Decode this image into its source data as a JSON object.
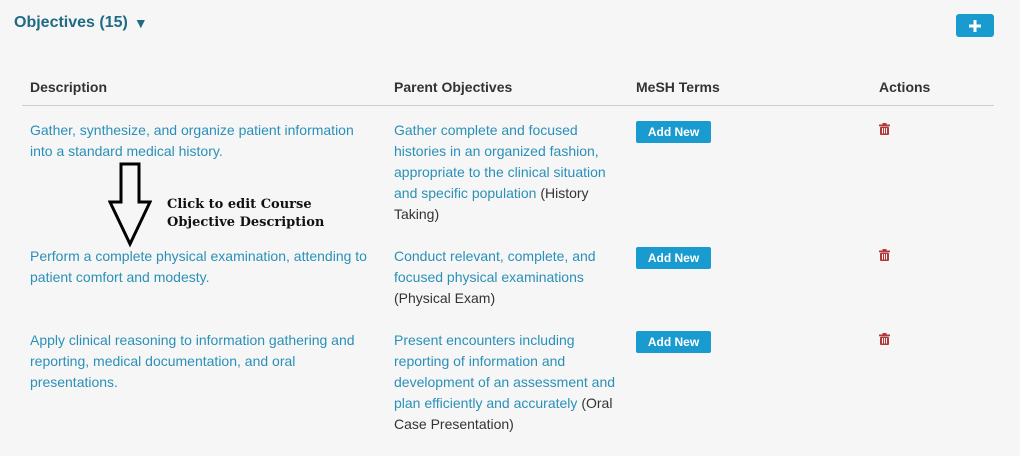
{
  "header": {
    "title": "Objectives (15)",
    "caret_icon": "triangle-down-icon"
  },
  "toolbar": {
    "add_icon": "plus-icon",
    "accent_color": "#1a9bd0"
  },
  "table": {
    "columns": {
      "description": "Description",
      "parent": "Parent Objectives",
      "mesh": "MeSH Terms",
      "actions": "Actions"
    },
    "rows": [
      {
        "description": "Gather, synthesize, and organize patient information into a standard medical history.",
        "parent_text": "Gather complete and focused histories in an organized fashion, appropriate to the clinical situation and specific population",
        "parent_tag": "(History Taking)",
        "mesh_button": "Add New"
      },
      {
        "description": "Perform a complete physical examination, attending to patient comfort and modesty.",
        "parent_text": "Conduct relevant, complete, and focused physical examinations",
        "parent_tag": "(Physical Exam)",
        "mesh_button": "Add New"
      },
      {
        "description": "Apply clinical reasoning to information gathering and reporting, medical documentation, and oral presentations.",
        "parent_text": "Present encounters including reporting of information and development of an assessment and plan efficiently and accurately",
        "parent_tag": "(Oral Case Presentation)",
        "mesh_button": "Add New"
      }
    ]
  },
  "annotation": {
    "line1": "Click to edit Course",
    "line2": "Objective Description"
  },
  "colors": {
    "link": "#2a90b8",
    "title": "#1f6b86",
    "trash": "#b03a3a"
  }
}
